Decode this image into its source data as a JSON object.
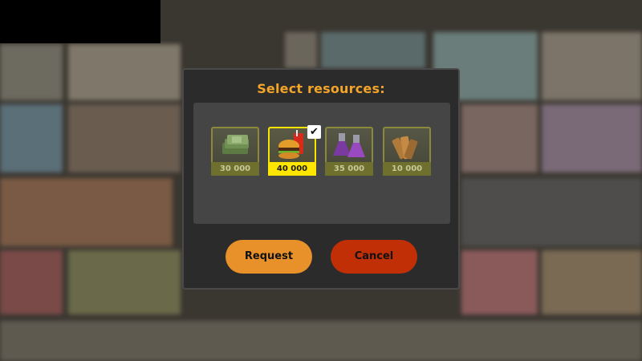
{
  "dialog": {
    "title": "Select resources:",
    "resources": [
      {
        "name": "caps",
        "icon": "cash-stack-icon",
        "amount": "30 000",
        "selected": false
      },
      {
        "name": "food",
        "icon": "burger-soda-icon",
        "amount": "40 000",
        "selected": true
      },
      {
        "name": "water",
        "icon": "flask-icon",
        "amount": "35 000",
        "selected": false
      },
      {
        "name": "wood",
        "icon": "wood-planks-icon",
        "amount": "10 000",
        "selected": false
      }
    ],
    "buttons": {
      "request": "Request",
      "cancel": "Cancel"
    }
  },
  "colors": {
    "title": "#f3a52a",
    "selected": "#ffe600",
    "request_button": "#e8902a",
    "cancel_button": "#c12f07"
  }
}
